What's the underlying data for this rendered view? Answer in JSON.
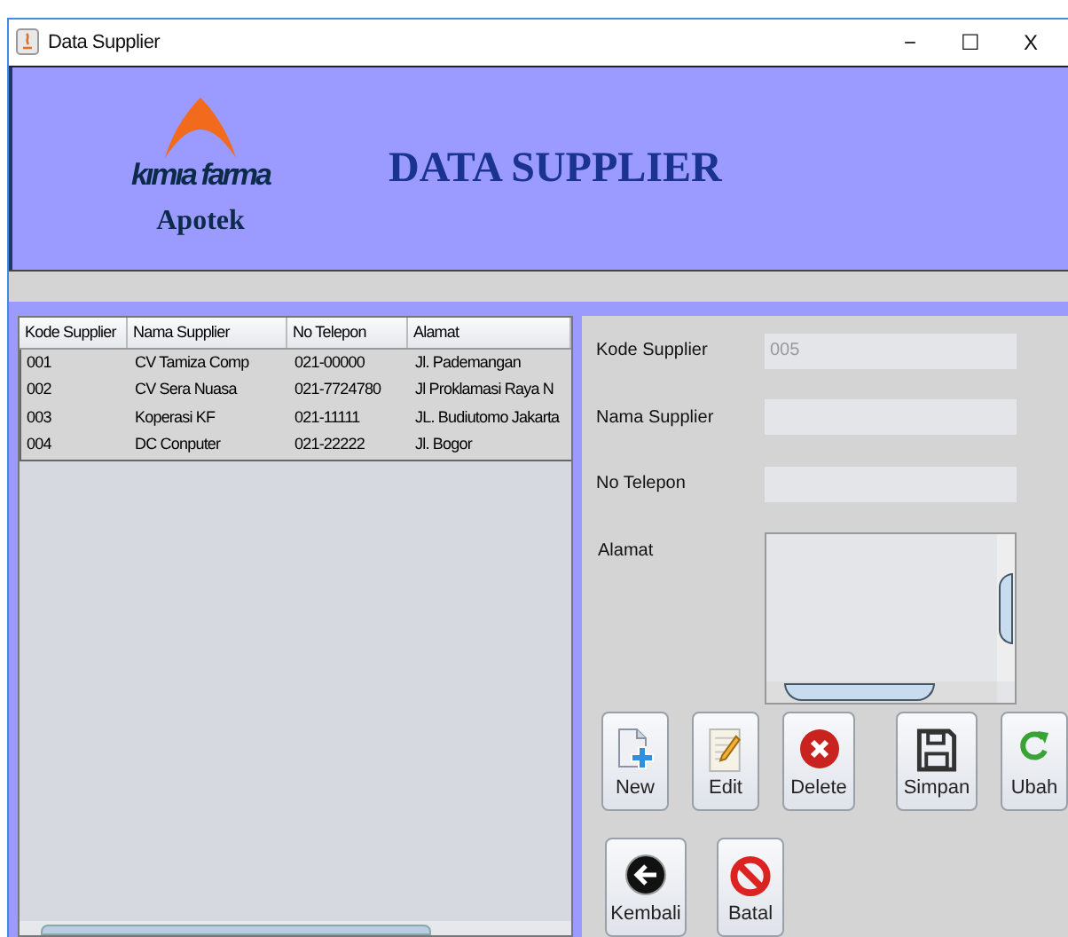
{
  "window": {
    "title": "Data Supplier",
    "controls": [
      "−",
      "☐",
      "X"
    ]
  },
  "header": {
    "logo_top": "kımıa farma",
    "logo_bottom": "Apotek",
    "title": "DATA SUPPLIER"
  },
  "table": {
    "columns": [
      "Kode Supplier",
      "Nama Supplier",
      "No Telepon",
      "Alamat"
    ],
    "rows": [
      [
        "001",
        "CV Tamiza Comp",
        "021-00000",
        "Jl. Pademangan"
      ],
      [
        "002",
        "CV Sera Nuasa",
        "021-7724780",
        "Jl Proklamasi Raya N"
      ],
      [
        "003",
        "Koperasi KF",
        "021-11111",
        "JL. Budiutomo Jakarta"
      ],
      [
        "004",
        "DC Conputer",
        "021-22222",
        "Jl. Bogor"
      ]
    ]
  },
  "form": {
    "fields": [
      {
        "label": "Kode Supplier",
        "value": "005",
        "disabled": true
      },
      {
        "label": "Nama Supplier"
      },
      {
        "label": "No Telepon"
      }
    ],
    "address_label": "Alamat"
  },
  "buttons": [
    [
      {
        "label": "New"
      },
      {
        "label": "Edit"
      },
      {
        "label": "Delete"
      },
      {
        "label": "Simpan"
      },
      {
        "label": "Ubah"
      }
    ],
    [
      {
        "label": "Kembali"
      },
      {
        "label": "Batal"
      }
    ]
  ]
}
